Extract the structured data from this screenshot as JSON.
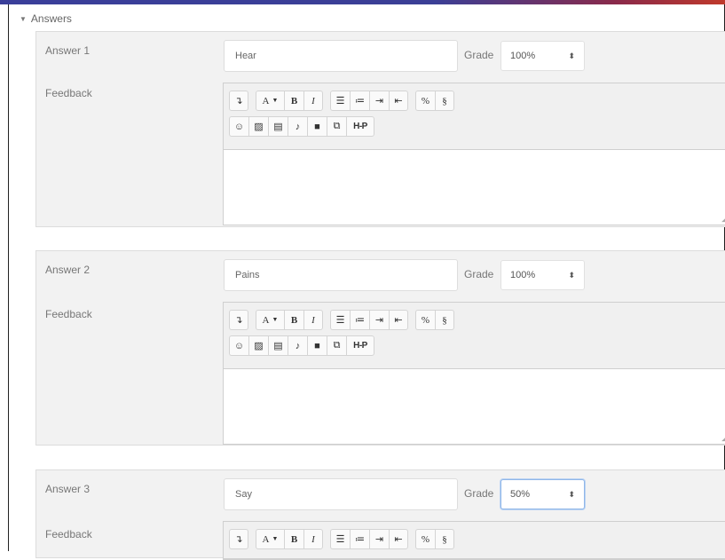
{
  "section": {
    "title": "Answers"
  },
  "labels": {
    "feedback": "Feedback",
    "grade": "Grade"
  },
  "answers": [
    {
      "label": "Answer 1",
      "value": "Hear",
      "grade": "100%"
    },
    {
      "label": "Answer 2",
      "value": "Pains",
      "grade": "100%"
    },
    {
      "label": "Answer 3",
      "value": "Say",
      "grade": "50%"
    }
  ],
  "toolbar": {
    "row1": [
      "collapse",
      "font-color",
      "bold",
      "italic",
      "unordered-list",
      "ordered-list",
      "indent",
      "outdent",
      "link",
      "unlink"
    ],
    "row2": [
      "emoticon",
      "image",
      "media",
      "record-audio",
      "record-video",
      "manage-files",
      "h5p"
    ],
    "font_color_label": "A",
    "bold_label": "B",
    "italic_label": "I",
    "h5p_label": "H-P"
  },
  "colors": {
    "accent": "#3b3f96",
    "focus_border": "#8fb6e8",
    "block_bg": "#f2f2f2"
  }
}
